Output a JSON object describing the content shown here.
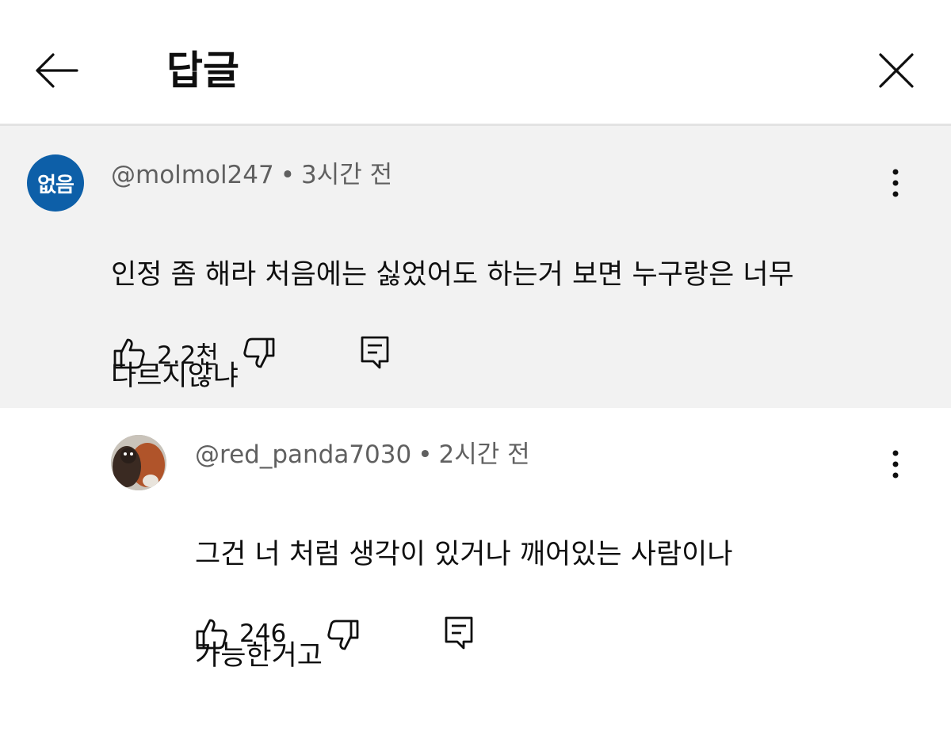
{
  "header": {
    "title": "답글"
  },
  "parent_comment": {
    "avatar_text": "없음",
    "avatar_color": "#0d5fa8",
    "username": "@molmol247",
    "separator": "•",
    "time": "3시간 전",
    "text_line1": "인정 좀 해라 처음에는 싫었어도 하는거 보면 누구랑은 너무",
    "text_line2": "다르지않냐",
    "likes": "2.2천"
  },
  "reply": {
    "username": "@red_panda7030",
    "separator": "•",
    "time": "2시간 전",
    "text_line1": "그건 너 처럼 생각이 있거나 깨어있는 사람이나",
    "text_line2": "가능한거고",
    "likes": "246"
  },
  "icons": {
    "back": "arrow-left-icon",
    "close": "close-icon",
    "more": "more-vertical-icon",
    "like": "thumbs-up-icon",
    "dislike": "thumbs-down-icon",
    "reply": "comment-icon"
  },
  "colors": {
    "parent_background": "#f2f2f2",
    "meta_text": "#606060"
  }
}
